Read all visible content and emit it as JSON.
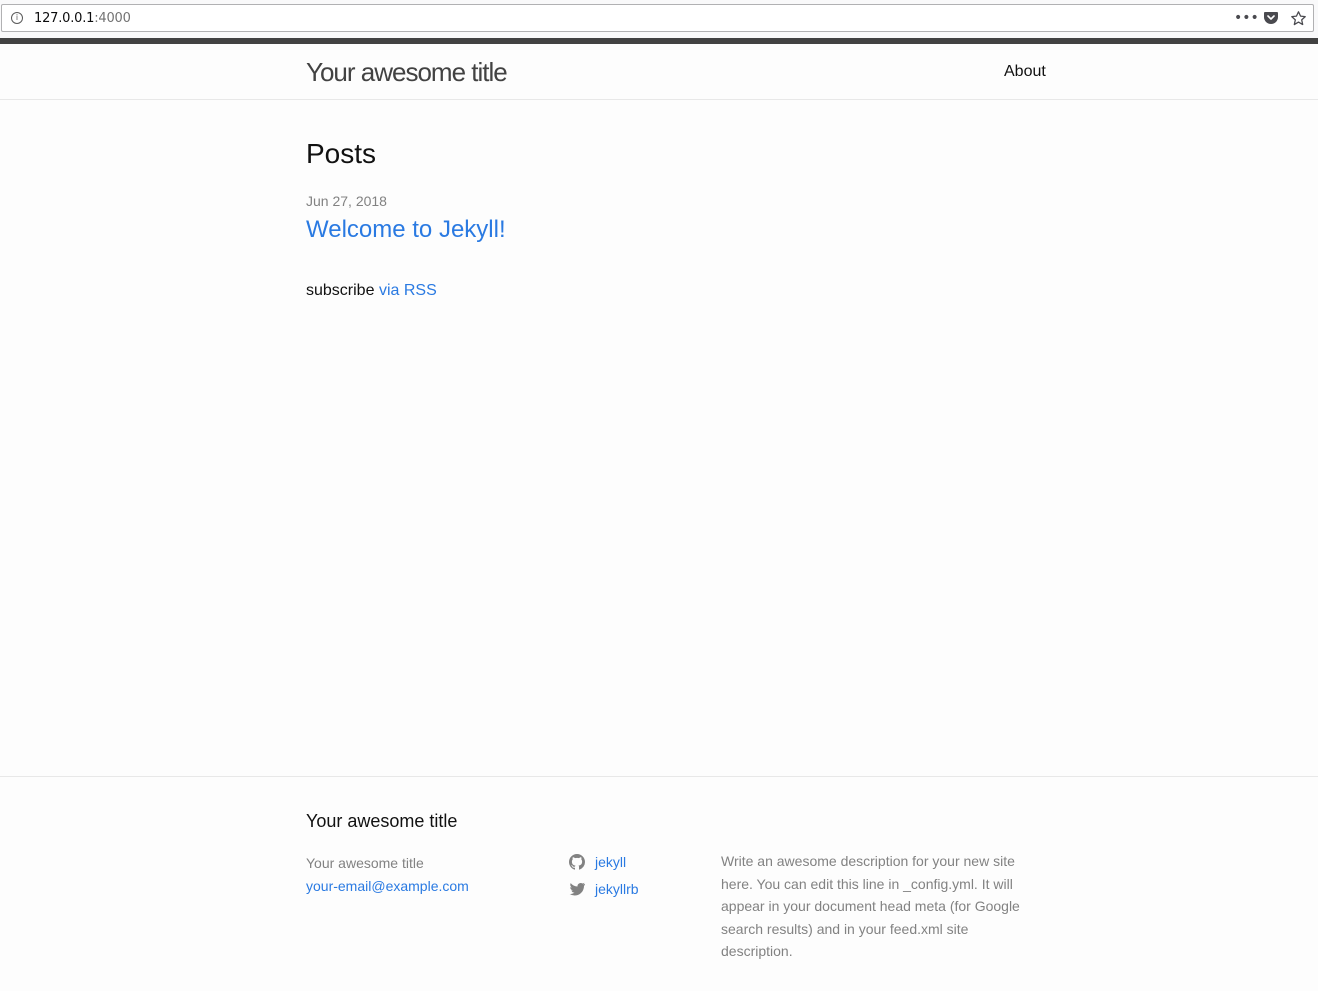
{
  "browser": {
    "url_host": "127.0.0.1",
    "url_port": ":4000",
    "info_icon": "info-icon",
    "actions": [
      "more-icon",
      "pocket-icon",
      "bookmark-star-icon"
    ]
  },
  "header": {
    "site_title": "Your awesome title",
    "nav_about": "About"
  },
  "main": {
    "heading": "Posts",
    "posts": [
      {
        "date": "Jun 27, 2018",
        "title": "Welcome to Jekyll!"
      }
    ],
    "rss_prefix": "subscribe",
    "rss_link": "via RSS"
  },
  "footer": {
    "heading": "Your awesome title",
    "site_name": "Your awesome title",
    "email": "your-email@example.com",
    "social": [
      {
        "icon": "github-icon",
        "label": "jekyll"
      },
      {
        "icon": "twitter-icon",
        "label": "jekyllrb"
      }
    ],
    "description": "Write an awesome description for your new site here. You can edit this line in _config.yml. It will appear in your document head meta (for Google search results) and in your feed.xml site description."
  },
  "colors": {
    "link": "#2a7ae2",
    "muted": "#828282",
    "stripe": "#424242"
  }
}
